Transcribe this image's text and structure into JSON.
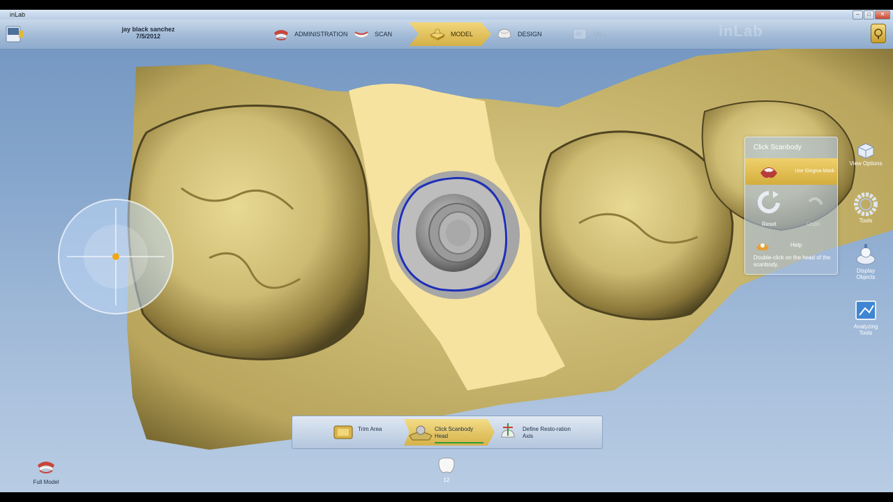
{
  "window": {
    "app_title": "inLab",
    "controls": [
      "–",
      "□",
      "✕"
    ]
  },
  "header": {
    "patient_name": "jay black sanchez",
    "date": "7/5/2012",
    "steps": [
      {
        "label": "ADMINISTRATION",
        "state": "normal"
      },
      {
        "label": "SCAN",
        "state": "normal"
      },
      {
        "label": "MODEL",
        "state": "active"
      },
      {
        "label": "DESIGN",
        "state": "normal"
      },
      {
        "label": "MILL",
        "state": "disabled"
      }
    ],
    "watermark": "inLab"
  },
  "panel": {
    "title": "Click Scanbody",
    "gingiva_label": "Use Gingiva Mask",
    "reset_label": "Reset",
    "undo_label": "Undo",
    "help_label": "Help",
    "help_text": "Double-click on the head of the scanbody."
  },
  "right_tools": [
    {
      "label": "View Options",
      "icon": "cube-view-icon"
    },
    {
      "label": "Tools",
      "icon": "gear-ring-icon"
    },
    {
      "label": "Display Objects",
      "icon": "display-objects-icon"
    },
    {
      "label": "Analyzing Tools",
      "icon": "analyzing-tools-icon"
    }
  ],
  "stepbar": {
    "back_arrow": "«",
    "forward_arrow": "»",
    "steps": [
      {
        "label": "Trim Area",
        "state": "normal"
      },
      {
        "label": "Click Scanbody Head",
        "state": "active"
      },
      {
        "label": "Define Resto-ration Axis",
        "state": "normal"
      }
    ]
  },
  "bottom": {
    "full_model_label": "Full Model",
    "tooth_number": "12"
  },
  "colors": {
    "accent_gold": "#d9b54a",
    "model_yellow": "#cdbb72",
    "model_light": "#f6e3a0",
    "scanbody_outline": "#1d2fb8",
    "background_blue": "#86a6cc"
  }
}
